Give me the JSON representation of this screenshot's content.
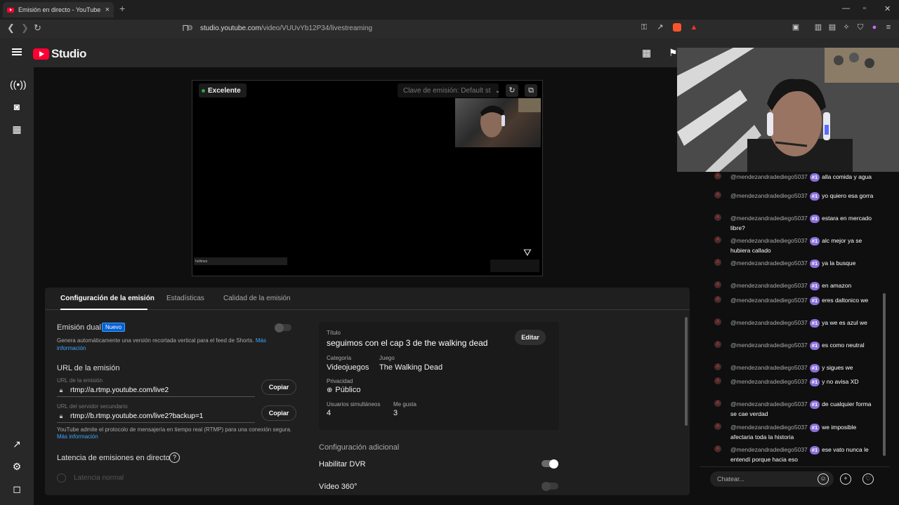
{
  "browser": {
    "tab_title": "Emisión en directo - YouTube Stu",
    "new_tab_icon": "plus-icon",
    "url_host": "studio.youtube.com",
    "url_path": "/video/VUUvYb12P34/livestreaming"
  },
  "studio": {
    "logo_text": "Studio"
  },
  "preview": {
    "status": "Excelente",
    "status_color": "#2ba640",
    "stream_key": "Clave de emisión: Default st",
    "overlay_label": "hollmes"
  },
  "tabs": [
    {
      "label": "Configuración de la emisión"
    },
    {
      "label": "Estadísticas"
    },
    {
      "label": "Calidad de la emisión"
    }
  ],
  "settings": {
    "dual_title": "Emisión dual",
    "dual_badge": "Nuevo",
    "dual_desc": "Genera automáticamente una versión recortada vertical para el feed de Shorts.",
    "dual_more": "Más información",
    "url_section": "URL de la emisión",
    "url_label": "URL de la emisión",
    "url_value": "rtmp://a.rtmp.youtube.com/live2",
    "backup_label": "URL del servidor secundario",
    "backup_value": "rtmp://b.rtmp.youtube.com/live2?backup=1",
    "copy_label": "Copiar",
    "rtmp_note": "YouTube admite el protocolo de mensajería en tiempo real (RTMP) para una conexión segura.",
    "rtmp_more": "Más información",
    "latency_title": "Latencia de emisiones en directo",
    "latency_option": "Latencia normal"
  },
  "info": {
    "title_label": "Título",
    "title_value": "seguimos con el cap 3 de the walking dead",
    "edit_label": "Editar",
    "category_label": "Categoría",
    "category_value": "Videojuegos",
    "game_label": "Juego",
    "game_value": "The Walking Dead",
    "privacy_label": "Privacidad",
    "privacy_value": "Público",
    "viewers_label": "Usuarios simultáneos",
    "viewers_value": "4",
    "likes_label": "Me gusta",
    "likes_value": "3"
  },
  "additional": {
    "title": "Configuración adicional",
    "dvr_label": "Habilitar DVR",
    "dvr_on": true,
    "video360_label": "Vídeo 360°",
    "video360_on": false
  },
  "chat": {
    "badge": "#1",
    "messages": [
      {
        "user": "@mendezandradediego5037",
        "text": "alla comida y agua"
      },
      {
        "user": "@mendezandradediego5037",
        "text": "yo quiero esa gorra"
      },
      {
        "user": "@mendezandradediego5037",
        "text": "estara en mercado libre?"
      },
      {
        "user": "@mendezandradediego5037",
        "text": "alc mejor ya se hubiera callado"
      },
      {
        "user": "@mendezandradediego5037",
        "text": "ya la busque"
      },
      {
        "user": "@mendezandradediego5037",
        "text": "en amazon"
      },
      {
        "user": "@mendezandradediego5037",
        "text": "eres daltonico we"
      },
      {
        "user": "@mendezandradediego5037",
        "text": "ya we es azul we"
      },
      {
        "user": "@mendezandradediego5037",
        "text": "es como neutral"
      },
      {
        "user": "@mendezandradediego5037",
        "text": "y sigues we"
      },
      {
        "user": "@mendezandradediego5037",
        "text": "y no avisa XD"
      },
      {
        "user": "@mendezandradediego5037",
        "text": "de cualquier forma se cae verdad"
      },
      {
        "user": "@mendezandradediego5037",
        "text": "we imposible afectaria toda la historia"
      },
      {
        "user": "@mendezandradediego5037",
        "text": "ese vato nunca le entendí porque hacia eso"
      }
    ],
    "input_placeholder": "Chatear..."
  }
}
